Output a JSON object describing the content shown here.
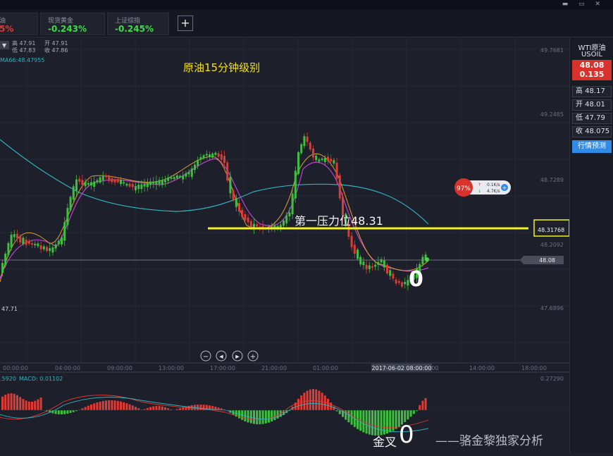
{
  "window": {
    "controls": "▬ ▭ ✕"
  },
  "tabs": [
    {
      "name": "油",
      "value": "5%"
    },
    {
      "name": "现货黄金",
      "value": "-0.243%"
    },
    {
      "name": "上证综指",
      "value": "-0.245%"
    }
  ],
  "add_tab_label": "+",
  "ohlc_info": {
    "high": "高 47.91",
    "open": "开 47.91",
    "low": "低 47.83",
    "close": "收 47.86"
  },
  "ma_label": "MA66:48.47955",
  "annotation_title": "原油15分钟级别",
  "resistance_label": "第一压力位48.31",
  "resistance_price": "48.31768",
  "current_price_tag": "48.08",
  "low_marker": "47.71",
  "circle_marks": [
    "0",
    "0"
  ],
  "golden_cross_label": "金叉",
  "watermark": "——骆金黎独家分析",
  "crosshair_time": "2017-06-02 08:00:00",
  "y_axis_ticks": [
    "49.7681",
    "49.2485",
    "48.7289",
    "48.2092",
    "47.6896"
  ],
  "x_axis_ticks": [
    "00:00:00",
    "04:00:00",
    "09:00:00",
    "13:00:00",
    "17:00:00",
    "21:00:00",
    "01:00:00",
    "06:00:00",
    "10:00",
    "14:00:00",
    "18:00:00"
  ],
  "macd": {
    "left_value": ".5920",
    "label": "MACD: 0.01102",
    "top_tick": "0.27290"
  },
  "speed_widget": {
    "percent": "97%",
    "up": "0.1K/s",
    "down": "4.7K/s"
  },
  "side_panel": {
    "title": "WTI原油",
    "symbol": "USOIL",
    "price": "48.08",
    "change": "0.135",
    "high": "高 48.17",
    "open": "开 48.01",
    "low": "低 47.79",
    "close": "收 48.075",
    "predict_button": "行情预测"
  },
  "zoom_controls": [
    "−",
    "◀",
    "▶",
    "+"
  ],
  "colors": {
    "up": "#3fbf3f",
    "down": "#e03a34",
    "ma_slow": "#2fb3c0",
    "ma_mid": "#c040d0",
    "ma_fast": "#e0a030",
    "resistance": "#f2f21c"
  }
}
